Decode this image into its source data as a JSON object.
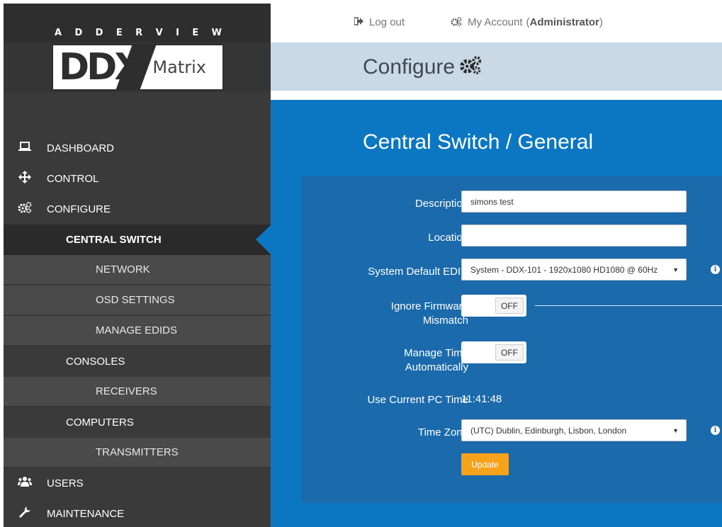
{
  "brand": {
    "wordmark": [
      "A",
      "D",
      "D",
      "E",
      "R",
      "V",
      "I",
      "E",
      "W"
    ],
    "logo_main": "DDX",
    "logo_sub": "Matrix"
  },
  "topbar": {
    "logout_label": "Log out",
    "account_label": "My Account",
    "account_role_open": "(",
    "account_role": "Administrator",
    "account_role_close": ")"
  },
  "header": {
    "title": "Configure"
  },
  "sidebar": {
    "items": [
      {
        "label": "DASHBOARD",
        "icon": "laptop-icon"
      },
      {
        "label": "CONTROL",
        "icon": "move-arrows-icon"
      },
      {
        "label": "CONFIGURE",
        "icon": "gears-icon"
      },
      {
        "label": "CENTRAL SWITCH",
        "active": true
      },
      {
        "label": "NETWORK"
      },
      {
        "label": "OSD SETTINGS"
      },
      {
        "label": "MANAGE EDIDS"
      },
      {
        "label": "CONSOLES"
      },
      {
        "label": "RECEIVERS"
      },
      {
        "label": "COMPUTERS"
      },
      {
        "label": "TRANSMITTERS"
      },
      {
        "label": "USERS",
        "icon": "users-icon"
      },
      {
        "label": "MAINTENANCE",
        "icon": "wrench-icon"
      }
    ]
  },
  "main": {
    "section_title": "Central Switch / General",
    "form": {
      "description_label": "Description",
      "description_value": "simons test",
      "location_label": "Location",
      "location_value": "",
      "edid_label": "System Default EDID",
      "edid_value": "System - DDX-101 - 1920x1080 HD1080 @ 60Hz",
      "firmware_label_1": "Ignore Firmware",
      "firmware_label_2": "Mismatch",
      "firmware_value": "OFF",
      "time_auto_label_1": "Manage Time",
      "time_auto_label_2": "Automatically",
      "time_auto_value": "OFF",
      "pc_time_label": "Use Current PC Time",
      "pc_time_value": "11:41:48",
      "timezone_label": "Time Zone",
      "timezone_value": "(UTC) Dublin, Edinburgh, Lisbon, London",
      "update_label": "Update"
    }
  },
  "colors": {
    "sidebar_bg": "#3a3a3a",
    "main_bg": "#0b77c2",
    "panel_bg": "#1b6aab",
    "header_bg": "#c9d9e6",
    "update_btn": "#f7a21b"
  }
}
